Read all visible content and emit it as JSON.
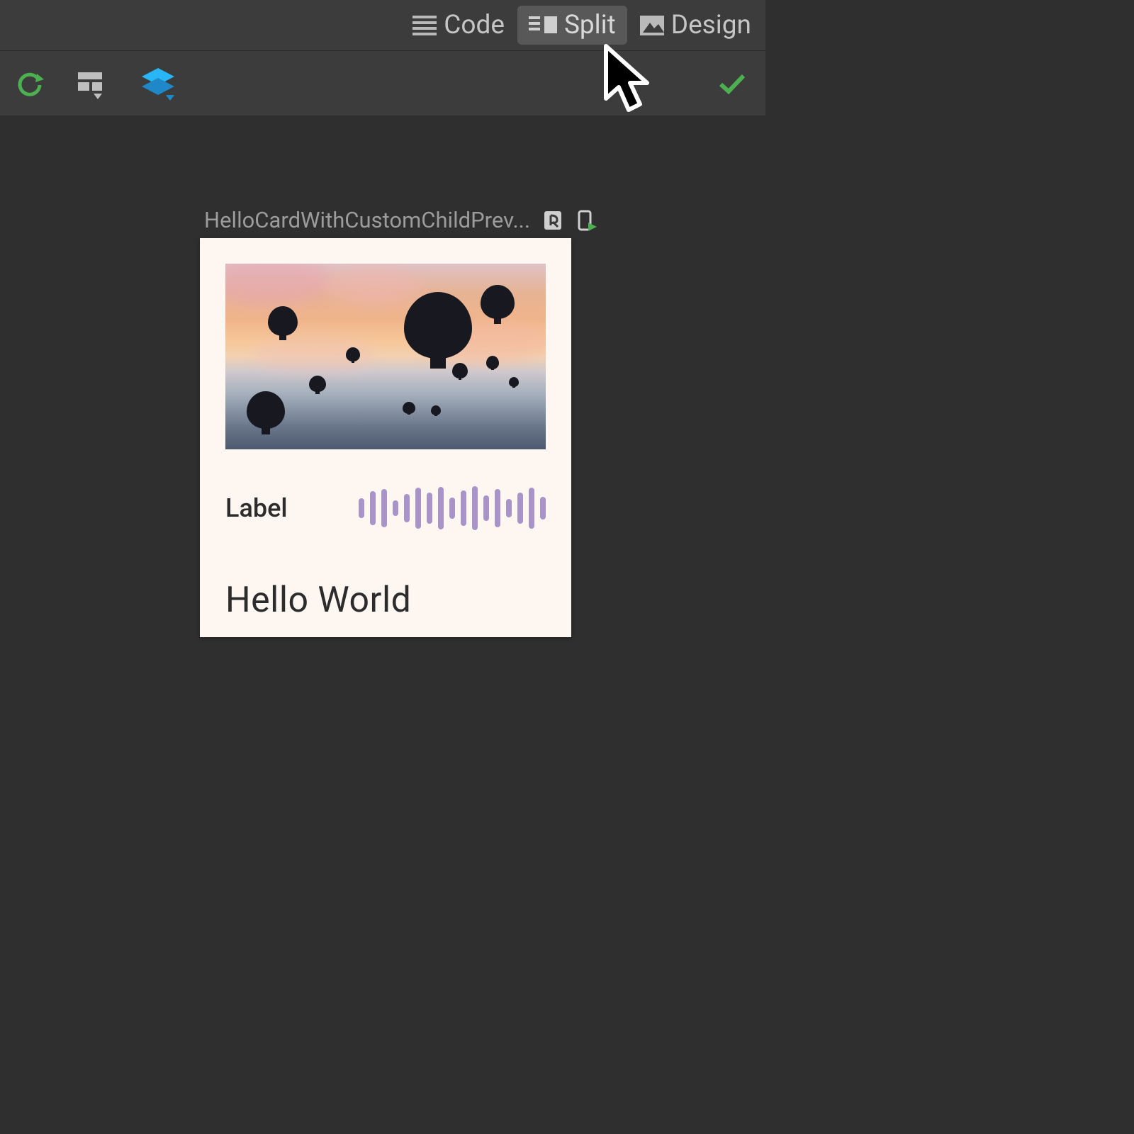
{
  "topbar": {
    "modes": {
      "code": {
        "label": "Code",
        "icon": "lines-icon"
      },
      "split": {
        "label": "Split",
        "icon": "split-icon",
        "active": true
      },
      "design": {
        "label": "Design",
        "icon": "image-icon"
      }
    }
  },
  "toolbar": {
    "icons": {
      "refresh": "refresh-icon",
      "surface": "surface-select-icon",
      "layers": "layers-icon",
      "status": "ok-check-icon"
    }
  },
  "preview": {
    "name": "HelloCardWithCustomChildPrev...",
    "icons": {
      "interactive": "interactive-preview-icon",
      "device": "run-on-device-icon"
    }
  },
  "card": {
    "label": "Label",
    "title": "Hello World",
    "image_alt": "hot air balloons at sunset",
    "wave_heights": [
      28,
      48,
      54,
      22,
      40,
      58,
      44,
      60,
      30,
      50,
      62,
      36,
      54,
      26,
      44,
      58,
      32
    ]
  },
  "colors": {
    "accent_green": "#4caf50",
    "accent_blue": "#29b6f6",
    "wave": "#a894c7",
    "card_bg": "#fdf6f1"
  }
}
